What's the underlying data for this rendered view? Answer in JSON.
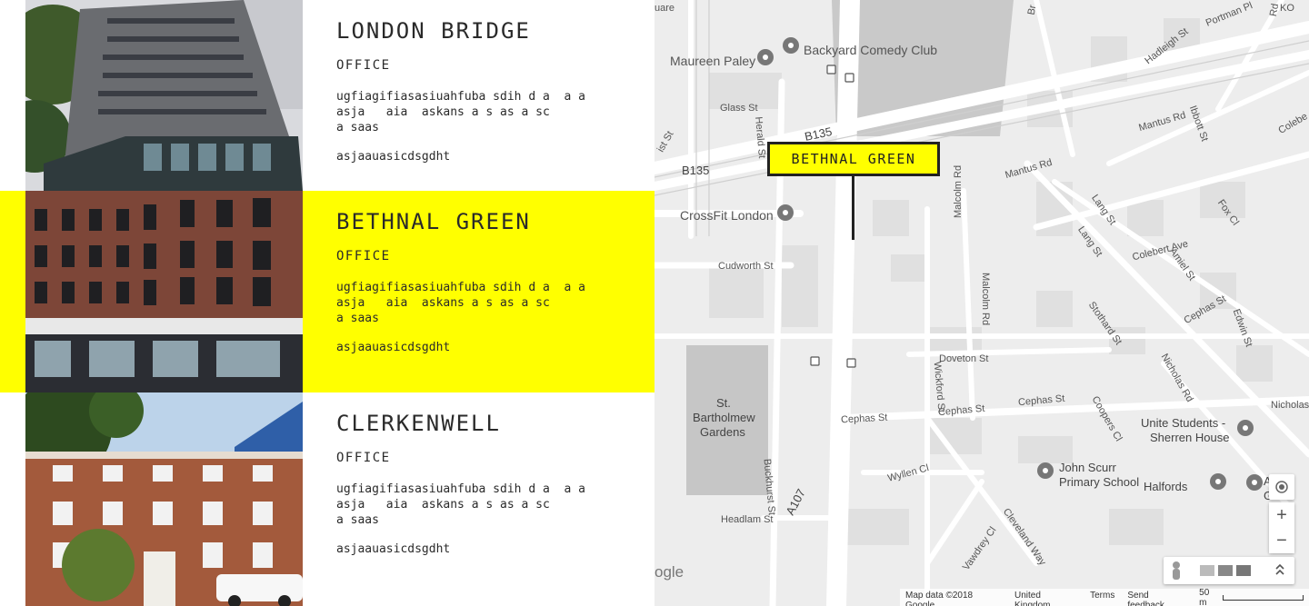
{
  "offices": [
    {
      "name": "LONDON BRIDGE",
      "type": "OFFICE",
      "description": "ugfiagifiasasiuahfuba sdih d a  a a\nasja   aia  askans a s as a sc\na saas",
      "extra": "asjaauasicdsgdht",
      "active": false
    },
    {
      "name": "BETHNAL GREEN",
      "type": "OFFICE",
      "description": "ugfiagifiasasiuahfuba sdih d a  a a\nasja   aia  askans a s as a sc\na saas",
      "extra": "asjaauasicdsgdht",
      "active": true
    },
    {
      "name": "CLERKENWELL",
      "type": "OFFICE",
      "description": "ugfiagifiasasiuahfuba sdih d a  a a\nasja   aia  askans a s as a sc\na saas",
      "extra": "asjaauasicdsgdht",
      "active": false
    }
  ],
  "map": {
    "marker_label": "BETHNAL GREEN",
    "places": {
      "backyard": "Backyard Comedy Club",
      "maureen": "Maureen Paley",
      "crossfit": "CrossFit London",
      "gardens_1": "St.",
      "gardens_2": "Bartholmew",
      "gardens_3": "Gardens",
      "unite_1": "Unite Students -",
      "unite_2": "Sherren House",
      "scurr_1": "John Scurr",
      "scurr_2": "Primary School",
      "halfords": "Halfords",
      "partial_1": "A",
      "partial_2": "G"
    },
    "streets": {
      "b135a": "B135",
      "b135b": "B135",
      "glass": "Glass St",
      "herald": "Herald St",
      "cudworth": "Cudworth St",
      "mantus": "Mantus Rd",
      "mantus2": "Mantus Rd",
      "malcolm": "Malcolm Rd",
      "malcolm2": "Malcolm Rd",
      "lang": "Lang St",
      "lang2": "Lang St",
      "colebert": "Colebert Ave",
      "amiel": "Amiel St",
      "fox": "Fox Cl",
      "cephas": "Cephas St",
      "cephas2": "Cephas St",
      "cephas3": "Cephas St",
      "edwin": "Edwin St",
      "stothard": "Stothard St",
      "doveton": "Doveton St",
      "wickford": "Wickford St",
      "nicholas": "Nicholas Rd",
      "nicholas2": "Nicholas",
      "coopers": "Coopers Cl",
      "wyllen": "Wyllen Cl",
      "buckhurst": "Buckhurst St",
      "a107": "A107",
      "headlam": "Headlam St",
      "vawdrey": "Vawdrey Cl",
      "cleveland": "Cleveland Way",
      "hadleigh": "Hadleigh St",
      "portman": "Portman Pl",
      "ibbott": "Ibbott St",
      "colebert2": "Colebe",
      "quare": "uare",
      "ko": "KO",
      "rd": "Rd",
      "ist": "ist St",
      "br": "Br"
    },
    "google_partial": "ogle",
    "footer": {
      "data": "Map data ©2018 Google",
      "region": "United Kingdom",
      "terms": "Terms",
      "feedback": "Send feedback",
      "scale": "50 m"
    },
    "controls": {
      "zoom_in": "+",
      "zoom_out": "−"
    }
  }
}
